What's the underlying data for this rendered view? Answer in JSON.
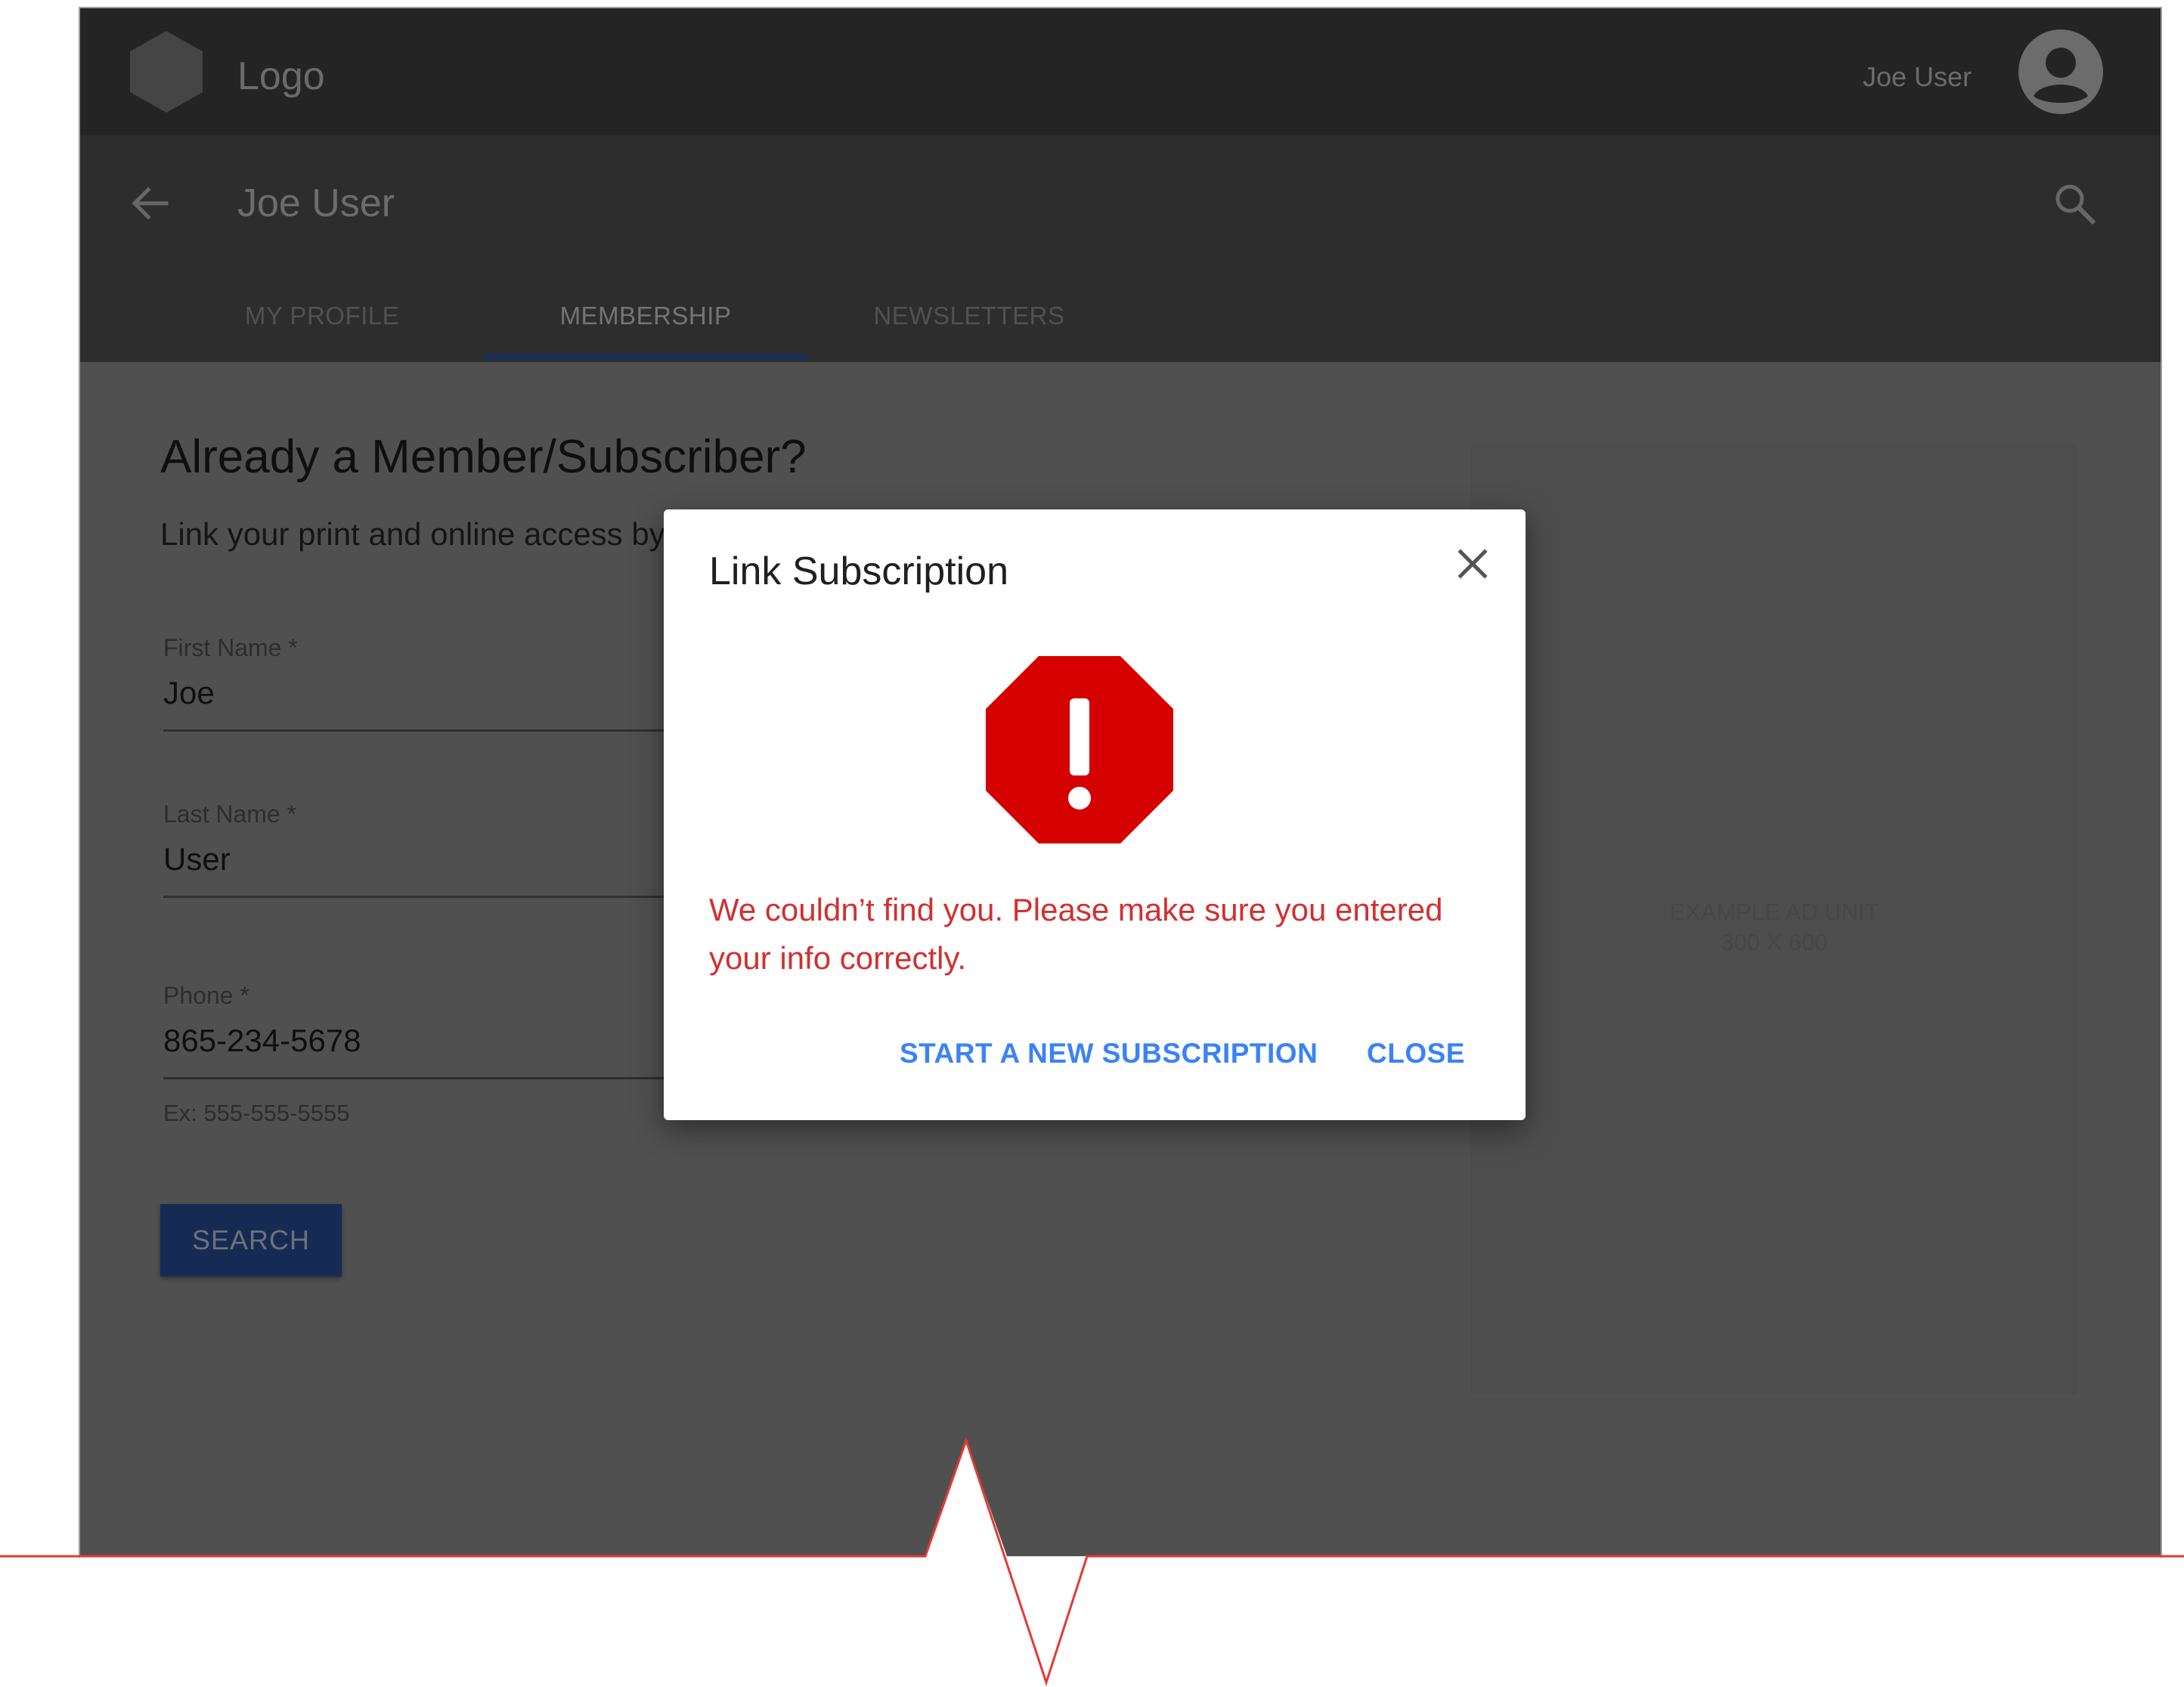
{
  "app": {
    "logo_text": "Logo",
    "user_name": "Joe User"
  },
  "subheader": {
    "title": "Joe User",
    "tabs": [
      {
        "label": "MY PROFILE",
        "active": false
      },
      {
        "label": "MEMBERSHIP",
        "active": true
      },
      {
        "label": "NEWSLETTERS",
        "active": false
      }
    ]
  },
  "form": {
    "headline": "Already a Member/Subscriber?",
    "subtext": "Link your print and online access by",
    "fields": [
      {
        "label": "First Name *",
        "value": "Joe"
      },
      {
        "label": "Last Name *",
        "value": "User"
      },
      {
        "label": "Phone *",
        "value": "865-234-5678",
        "hint": "Ex: 555-555-5555"
      }
    ],
    "search_label": "SEARCH"
  },
  "ad": {
    "line1": "EXAMPLE AD UNIT",
    "line2": "300 X 600"
  },
  "dialog": {
    "title": "Link Subscription",
    "error_message": "We couldn’t find you. Please make sure you entered your info correctly.",
    "primary_action": "START A NEW SUBSCRIPTION",
    "close_action": "CLOSE"
  },
  "colors": {
    "accent": "#3b82f6",
    "error": "#d32f2f",
    "warning_icon": "#d50000",
    "tab_indicator": "#2b5fc7"
  }
}
